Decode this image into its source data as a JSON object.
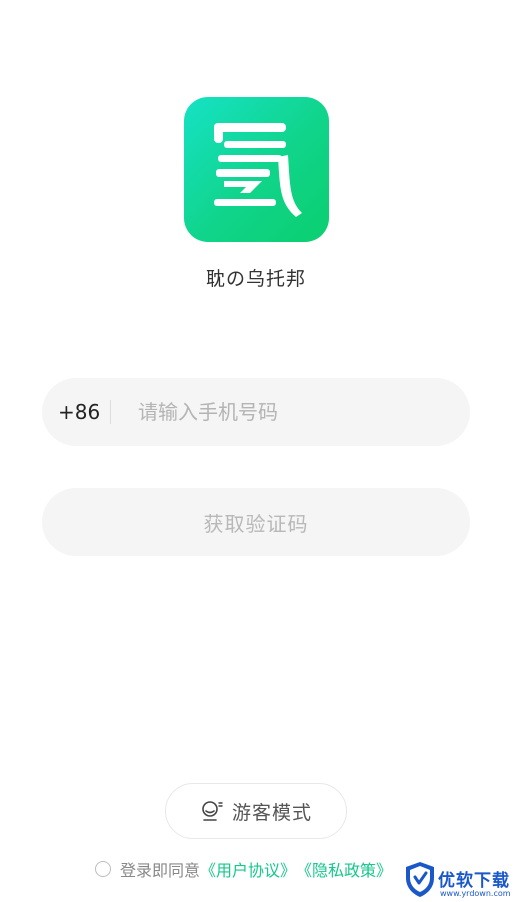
{
  "app": {
    "name": "耽の乌托邦",
    "logo_icon": "app-logo-icon",
    "brand_color": "#13d49a"
  },
  "login": {
    "country_code": "+86",
    "phone_placeholder": "请输入手机号码",
    "phone_value": "",
    "get_code_label": "获取验证码"
  },
  "guest": {
    "icon": "guest-mode-icon",
    "label": "游客模式"
  },
  "agreement": {
    "checked": false,
    "prefix": "登录即同意",
    "user_agreement": "《用户协议》",
    "privacy_policy": "《隐私政策》",
    "link_color": "#14c98a"
  },
  "watermark": {
    "title": "优软下载",
    "url": "www.yrdown.com"
  }
}
